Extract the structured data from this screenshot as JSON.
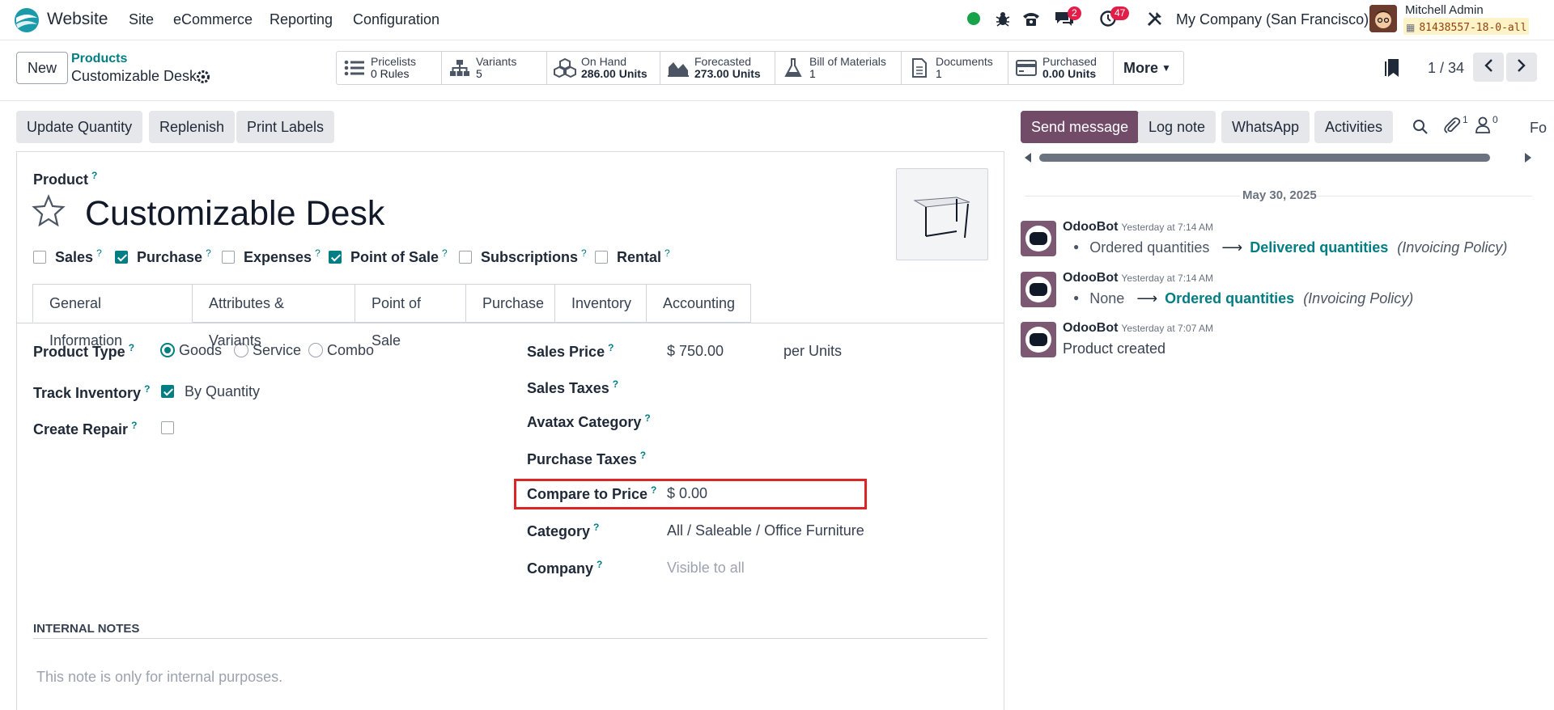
{
  "navbar": {
    "app_name": "Website",
    "menu": [
      "Site",
      "eCommerce",
      "Reporting",
      "Configuration"
    ],
    "messages_badge": "2",
    "activities_badge": "47",
    "company": "My Company (San Francisco)",
    "user_name": "Mitchell Admin",
    "database": "81438557-18-0-all"
  },
  "breadcrumb": {
    "parent": "Products",
    "current": "Customizable Desk"
  },
  "control": {
    "new_label": "New",
    "pager": "1 / 34",
    "more_label": "More"
  },
  "stat_buttons": [
    {
      "label": "Pricelists",
      "value": "0 Rules",
      "icon": "list-icon"
    },
    {
      "label": "Variants",
      "value": "5",
      "icon": "sitemap-icon"
    },
    {
      "label": "On Hand",
      "value": "286.00 Units",
      "icon": "cubes-icon"
    },
    {
      "label": "Forecasted",
      "value": "273.00 Units",
      "icon": "area-chart-icon"
    },
    {
      "label": "Bill of Materials",
      "value": "1",
      "icon": "flask-icon"
    },
    {
      "label": "Documents",
      "value": "1",
      "icon": "file-icon"
    },
    {
      "label": "Purchased",
      "value": "0.00 Units",
      "icon": "credit-card-icon"
    }
  ],
  "actions": [
    "Update Quantity",
    "Replenish",
    "Print Labels"
  ],
  "form": {
    "product_label": "Product",
    "product_name": "Customizable Desk",
    "flags": [
      {
        "label": "Sales",
        "checked": false
      },
      {
        "label": "Purchase",
        "checked": true
      },
      {
        "label": "Expenses",
        "checked": false
      },
      {
        "label": "Point of Sale",
        "checked": true
      },
      {
        "label": "Subscriptions",
        "checked": false
      },
      {
        "label": "Rental",
        "checked": false
      }
    ],
    "tabs": [
      "General Information",
      "Attributes & Variants",
      "Point of Sale",
      "Purchase",
      "Inventory",
      "Accounting"
    ],
    "product_type_label": "Product Type",
    "product_type_options": [
      "Goods",
      "Service",
      "Combo"
    ],
    "product_type_selected": "Goods",
    "track_inventory_label": "Track Inventory",
    "track_inventory_value": "By Quantity",
    "create_repair_label": "Create Repair",
    "sales_price_label": "Sales Price",
    "sales_price_value": "$ 750.00",
    "sales_price_unit": "per Units",
    "sales_taxes_label": "Sales Taxes",
    "avatax_label": "Avatax Category",
    "purchase_taxes_label": "Purchase Taxes",
    "compare_price_label": "Compare to Price",
    "compare_price_value": "$ 0.00",
    "category_label": "Category",
    "category_value": "All / Saleable / Office Furniture",
    "company_label": "Company",
    "company_placeholder": "Visible to all",
    "internal_notes_heading": "INTERNAL NOTES",
    "internal_notes_placeholder": "This note is only for internal purposes."
  },
  "chatter": {
    "send_message": "Send message",
    "log_note": "Log note",
    "whatsapp": "WhatsApp",
    "activities": "Activities",
    "attachments_count": "1",
    "followers_count": "0",
    "follow_label": "Fo",
    "date_separator": "May 30, 2025",
    "messages": [
      {
        "author": "OdooBot",
        "time": "Yesterday at 7:14 AM",
        "old": "Ordered quantities",
        "new": "Delivered quantities",
        "field": "(Invoicing Policy)"
      },
      {
        "author": "OdooBot",
        "time": "Yesterday at 7:14 AM",
        "old": "None",
        "new": "Ordered quantities",
        "field": "(Invoicing Policy)"
      },
      {
        "author": "OdooBot",
        "time": "Yesterday at 7:07 AM",
        "body": "Product created"
      }
    ]
  },
  "colors": {
    "brand_teal": "#017e84",
    "chatter_primary": "#714b67",
    "highlight_red": "#dc2626"
  }
}
